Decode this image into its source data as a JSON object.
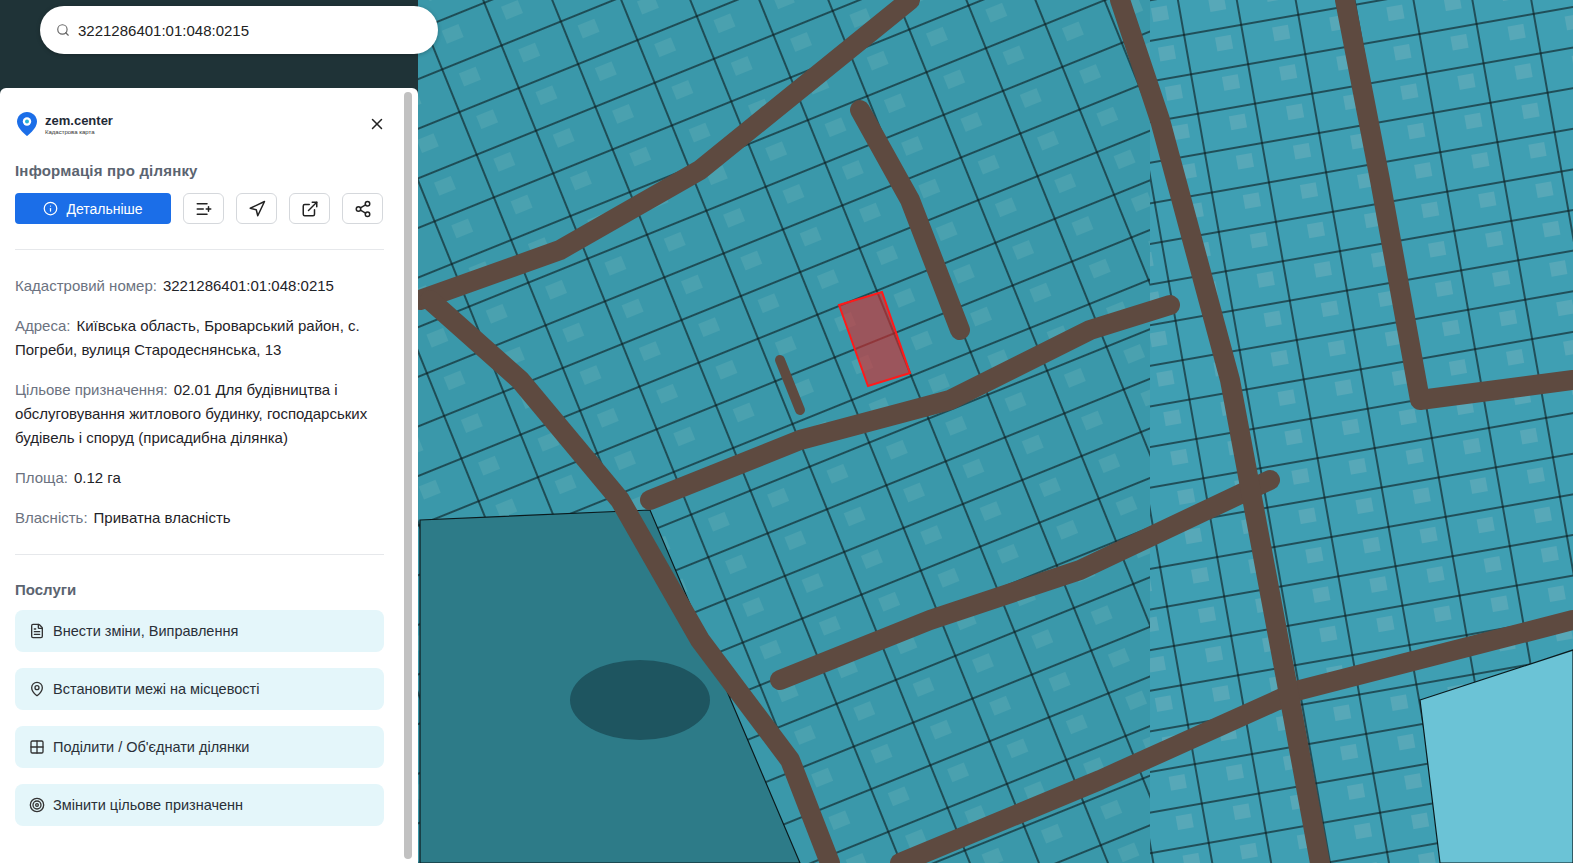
{
  "search": {
    "value": "3221286401:01:048:0215"
  },
  "logo": {
    "name": "zem.center",
    "subtitle": "Кадастрова карта"
  },
  "panel": {
    "title": "Інформація про ділянку",
    "primary_button": "Детальніше"
  },
  "fields": [
    {
      "label": "Кадастровий номер:",
      "value": "3221286401:01:048:0215"
    },
    {
      "label": "Адреса:",
      "value": "Київська область, Броварський район, с. Погреби, вулиця Стародеснянська, 13"
    },
    {
      "label": "Цільове призначення:",
      "value": "02.01 Для будівництва і обслуговування житлового будинку, господарських будівель і споруд (присадибна ділянка)"
    },
    {
      "label": "Площа:",
      "value": "0.12 га"
    },
    {
      "label": "Власність:",
      "value": "Приватна власність"
    }
  ],
  "services": {
    "title": "Послуги",
    "items": [
      {
        "label": "Внести зміни, Виправлення"
      },
      {
        "label": "Встановити межі на місцевості"
      },
      {
        "label": "Поділити / Об'єднати ділянки"
      },
      {
        "label": "Змінити цільове призначенн"
      }
    ]
  },
  "map": {
    "parcel_selected": true
  }
}
